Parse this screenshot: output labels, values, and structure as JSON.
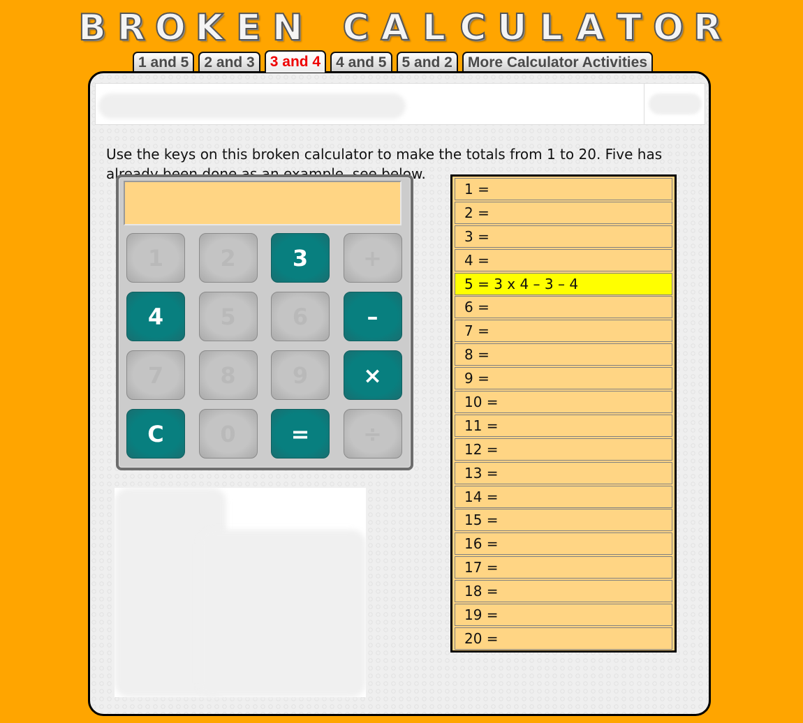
{
  "header": {
    "title_word1": [
      "B",
      "R",
      "O",
      "K",
      "E",
      "N"
    ],
    "title_word2": [
      "C",
      "A",
      "L",
      "C",
      "U",
      "L",
      "A",
      "T",
      "O",
      "R"
    ]
  },
  "tabs": [
    {
      "label": "1 and 5",
      "active": false
    },
    {
      "label": "2 and 3",
      "active": false
    },
    {
      "label": "3 and 4",
      "active": true
    },
    {
      "label": "4 and 5",
      "active": false
    },
    {
      "label": "5 and 2",
      "active": false
    },
    {
      "label": "More Calculator Activities",
      "active": false
    }
  ],
  "instructions": "Use the keys on this broken calculator to make the totals from 1 to 20. Five has already been done as an example, see below.",
  "calculator": {
    "display_value": "",
    "colors": {
      "working_key": "#087F7F",
      "broken_key": "#C4C4C4",
      "display": "#FFD584"
    },
    "keys": [
      {
        "label": "1",
        "working": false
      },
      {
        "label": "2",
        "working": false
      },
      {
        "label": "3",
        "working": true
      },
      {
        "label": "+",
        "working": false
      },
      {
        "label": "4",
        "working": true
      },
      {
        "label": "5",
        "working": false
      },
      {
        "label": "6",
        "working": false
      },
      {
        "label": "–",
        "working": true
      },
      {
        "label": "7",
        "working": false
      },
      {
        "label": "8",
        "working": false
      },
      {
        "label": "9",
        "working": false
      },
      {
        "label": "×",
        "working": true
      },
      {
        "label": "C",
        "working": true
      },
      {
        "label": "0",
        "working": false
      },
      {
        "label": "=",
        "working": true
      },
      {
        "label": "÷",
        "working": false
      }
    ]
  },
  "totals": {
    "highlight_color": "#FFFF00",
    "rows": [
      {
        "text": "1 =",
        "highlight": false
      },
      {
        "text": "2 =",
        "highlight": false
      },
      {
        "text": "3 =",
        "highlight": false
      },
      {
        "text": "4 =",
        "highlight": false
      },
      {
        "text": "5 = 3 x 4 – 3 – 4",
        "highlight": true
      },
      {
        "text": "6 =",
        "highlight": false
      },
      {
        "text": "7 =",
        "highlight": false
      },
      {
        "text": "8 =",
        "highlight": false
      },
      {
        "text": "9 =",
        "highlight": false
      },
      {
        "text": "10 =",
        "highlight": false
      },
      {
        "text": "11 =",
        "highlight": false
      },
      {
        "text": "12 =",
        "highlight": false
      },
      {
        "text": "13 =",
        "highlight": false
      },
      {
        "text": "14 =",
        "highlight": false
      },
      {
        "text": "15 =",
        "highlight": false
      },
      {
        "text": "16 =",
        "highlight": false
      },
      {
        "text": "17 =",
        "highlight": false
      },
      {
        "text": "18 =",
        "highlight": false
      },
      {
        "text": "19 =",
        "highlight": false
      },
      {
        "text": "20 =",
        "highlight": false
      }
    ]
  }
}
